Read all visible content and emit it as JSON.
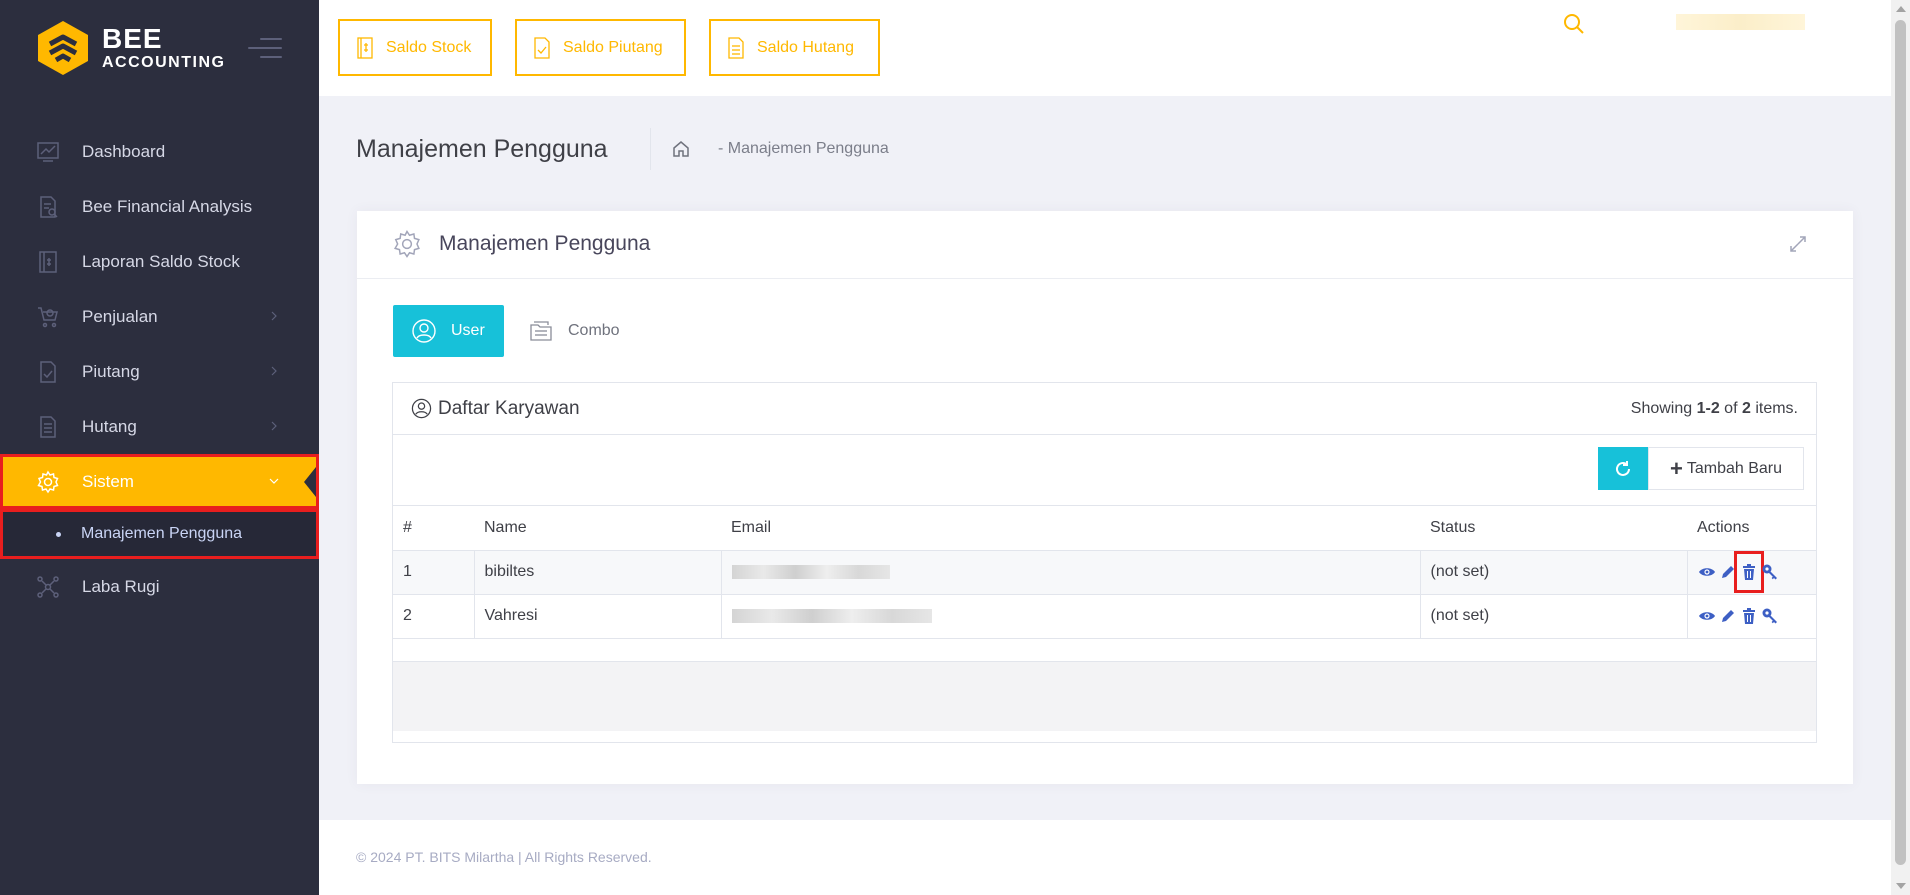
{
  "brand": {
    "line1": "BEE",
    "line2": "ACCOUNTING"
  },
  "sidebar": {
    "items": [
      {
        "label": "Dashboard",
        "icon": "chart-line-icon"
      },
      {
        "label": "Bee Financial Analysis",
        "icon": "document-analysis-icon"
      },
      {
        "label": "Laporan Saldo Stock",
        "icon": "stock-report-icon"
      },
      {
        "label": "Penjualan",
        "icon": "cart-icon"
      },
      {
        "label": "Piutang",
        "icon": "document-check-icon"
      },
      {
        "label": "Hutang",
        "icon": "document-lines-icon"
      },
      {
        "label": "Sistem",
        "icon": "gear-icon"
      },
      {
        "label": "Manajemen Pengguna"
      },
      {
        "label": "Laba Rugi",
        "icon": "network-icon"
      }
    ]
  },
  "topbar": {
    "buttons": [
      {
        "label": "Saldo Stock"
      },
      {
        "label": "Saldo Piutang"
      },
      {
        "label": "Saldo Hutang"
      }
    ]
  },
  "subheader": {
    "title": "Manajemen Pengguna",
    "breadcrumb": "-  Manajemen Pengguna"
  },
  "portlet": {
    "title": "Manajemen Pengguna",
    "tabs": [
      {
        "label": "User"
      },
      {
        "label": "Combo"
      }
    ],
    "panel": {
      "title": "Daftar Karyawan",
      "summary_prefix": "Showing ",
      "summary_range": "1-2",
      "summary_of": " of ",
      "summary_total": "2",
      "summary_suffix": " items.",
      "add_label": "Tambah Baru"
    },
    "table": {
      "headers": [
        "#",
        "Name",
        "Email",
        "Status",
        "Actions"
      ],
      "rows": [
        {
          "num": "1",
          "name": "bibiltes",
          "status": "(not set)"
        },
        {
          "num": "2",
          "name": "Vahresi",
          "status": "(not set)"
        }
      ]
    }
  },
  "footer": {
    "text": "© 2024 PT. BITS Milartha | All Rights Reserved."
  },
  "colors": {
    "accent": "#ffb800",
    "info": "#17c1d9",
    "sidebar_bg": "#2c2e3e",
    "action_blue": "#3d5fc4",
    "highlight": "#e81e1e"
  }
}
